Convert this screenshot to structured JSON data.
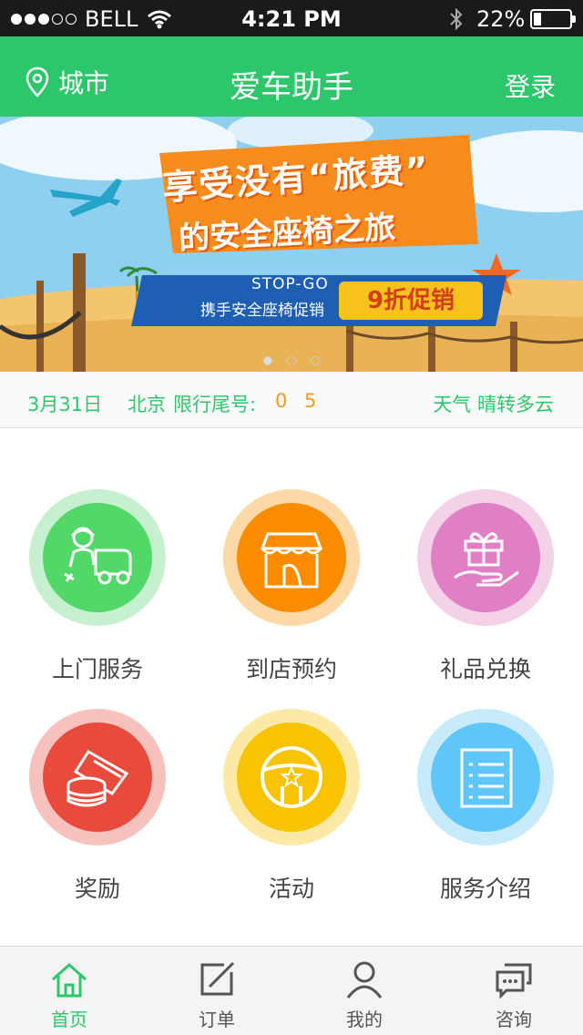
{
  "status_bar": {
    "carrier": "BELL",
    "signal_bars_filled": 3,
    "signal_bars_total": 5,
    "time": "4:21 PM",
    "battery_percent": "22%",
    "battery_level": 0.22
  },
  "navbar": {
    "city_label": "城市",
    "title": "爱车助手",
    "login_label": "登录"
  },
  "banner": {
    "headline_line1": "享受没有“旅费”",
    "headline_line2": "的安全座椅之旅",
    "brand": "STOP-GO",
    "subtitle": "携手安全座椅促销",
    "promo": "9折促销",
    "page_count": 3,
    "active_page": 1
  },
  "info": {
    "date": "3月31日",
    "city": "北京",
    "limit_label": "限行尾号:",
    "limit_value": "0 5",
    "weather": "天气  晴转多云"
  },
  "services": [
    {
      "label": "上门服务",
      "icon": "mechanic-car-icon",
      "ring": "#c6f0cf",
      "disc": "#52d769"
    },
    {
      "label": "到店预约",
      "icon": "storefront-icon",
      "ring": "#fdd9a8",
      "disc": "#fb8c00"
    },
    {
      "label": "礼品兑换",
      "icon": "gift-hand-icon",
      "ring": "#f3d2e8",
      "disc": "#e07fc4"
    },
    {
      "label": "奖励",
      "icon": "coins-card-icon",
      "ring": "#f7c2bd",
      "disc": "#e84a3c"
    },
    {
      "label": "活动",
      "icon": "steering-wheel-icon",
      "ring": "#fde9a6",
      "disc": "#f8c402"
    },
    {
      "label": "服务介绍",
      "icon": "document-list-icon",
      "ring": "#c8ebfb",
      "disc": "#5ec6f8"
    }
  ],
  "tabs": [
    {
      "label": "首页",
      "icon": "home-icon",
      "active": true
    },
    {
      "label": "订单",
      "icon": "edit-icon",
      "active": false
    },
    {
      "label": "我的",
      "icon": "user-icon",
      "active": false
    },
    {
      "label": "咨询",
      "icon": "chat-icon",
      "active": false
    }
  ],
  "colors": {
    "brand_green": "#2dc76b",
    "limit_orange": "#f39a1e"
  }
}
